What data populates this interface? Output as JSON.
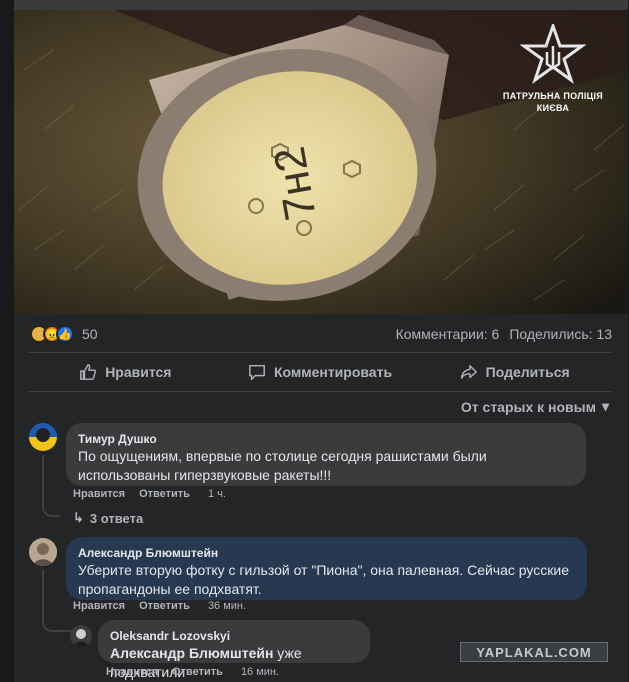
{
  "photo": {
    "alt": "Фото",
    "badge_line1": "ПАТРУЛЬНА ПОЛІЦІЯ",
    "badge_line2": "КИЄВА",
    "can_marking": "7н2"
  },
  "stats": {
    "reactions": [
      "sad",
      "angry",
      "like"
    ],
    "reaction_count": "50",
    "comments": "Комментарии: 6",
    "shares": "Поделились: 13"
  },
  "actions": {
    "like": "Нравится",
    "comment": "Комментировать",
    "share": "Поделиться"
  },
  "sort": {
    "label": "От старых к новым"
  },
  "comments": [
    {
      "author": "Тимур Душко",
      "text": "По ощущениям, впервые по столице сегодня рашистами были использованы гиперзвуковые ракеты!!!",
      "like": "Нравится",
      "reply": "Ответить",
      "time": "1 ч.",
      "replies_label": "3 ответа"
    },
    {
      "author": "Александр Блюмштейн",
      "text": "Уберите вторую фотку с гильзой от \"Пиона\", она палевная. Сейчас русские пропагандоны ее подхватят.",
      "like": "Нравится",
      "reply": "Ответить",
      "time": "36 мин."
    },
    {
      "author": "Oleksandr Lozovskyi",
      "mention": "Александр Блюмштейн",
      "text": " уже подхватили",
      "like": "Нравится",
      "reply": "Ответить",
      "time": "16 мин."
    }
  ],
  "watermark": "YAPLAKAL.COM"
}
